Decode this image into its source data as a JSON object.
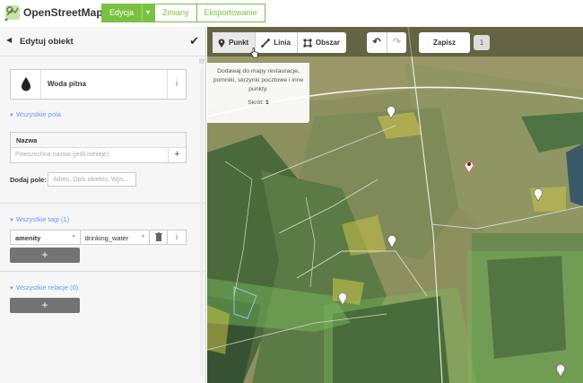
{
  "header": {
    "brand": "OpenStreetMap",
    "nav": [
      {
        "label": "Edycja",
        "active": true
      },
      {
        "label": "Zmiany",
        "active": false
      },
      {
        "label": "Eksportowanie",
        "active": false
      }
    ]
  },
  "sidebar": {
    "title": "Edytuj obiekt",
    "preset": {
      "name": "Woda pitna",
      "icon": "water-drop-icon"
    },
    "all_fields_label": "Wszystkie pola",
    "name_field": {
      "label": "Nazwa",
      "placeholder": "Powszechna nazwa (jeśli istnieje)"
    },
    "add_field": {
      "label": "Dodaj pole:",
      "placeholder": "Adres, Opis obiektu, Wys..."
    },
    "all_tags_label": "Wszystkie tagi (1)",
    "tags": [
      {
        "key": "amenity",
        "value": "drinking_water"
      }
    ],
    "all_relations_label": "Wszystkie relacje (0)",
    "add_symbol": "+"
  },
  "toolbar": {
    "point": "Punkt",
    "line": "Linia",
    "area": "Obszar",
    "save": "Zapisz",
    "count": "1"
  },
  "tooltip": {
    "text": "Dodawaj do mapy restauracje, pomniki, skrzynki pocztowe i inne punkty.",
    "shortcut_label": "Skrót:",
    "shortcut_key": "1"
  },
  "colors": {
    "accent": "#7ac142",
    "link": "#7092ff",
    "selected": "#e06e5f"
  }
}
